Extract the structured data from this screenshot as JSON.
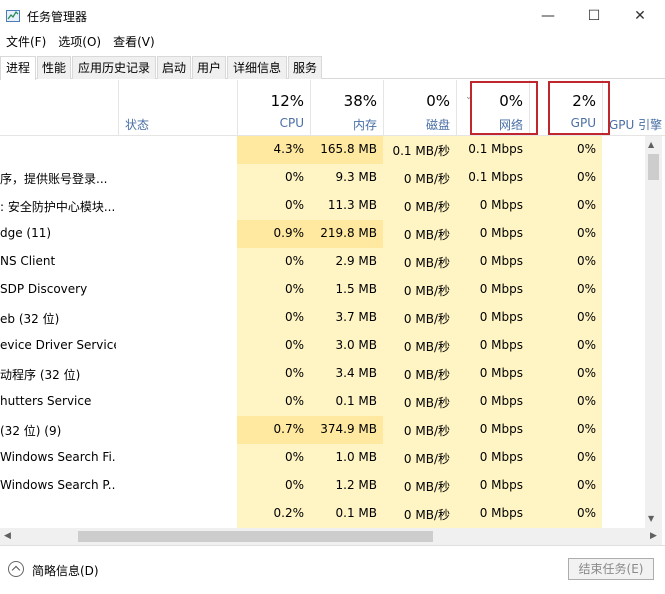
{
  "window": {
    "title": "任务管理器",
    "minimize": "—",
    "maximize": "☐",
    "close": "✕"
  },
  "menu": [
    "文件(F)",
    "选项(O)",
    "查看(V)"
  ],
  "tabs": [
    "进程",
    "性能",
    "应用历史记录",
    "启动",
    "用户",
    "详细信息",
    "服务"
  ],
  "active_tab": "进程",
  "columns": {
    "status": "状态",
    "cpu": {
      "percent": "12%",
      "label": "CPU"
    },
    "memory": {
      "percent": "38%",
      "label": "内存"
    },
    "disk": {
      "percent": "0%",
      "label": "磁盘"
    },
    "network": {
      "percent": "0%",
      "label": "网络"
    },
    "gpu": {
      "percent": "2%",
      "label": "GPU"
    },
    "gpu_engine": "GPU 引擎"
  },
  "rows": [
    {
      "name": "",
      "cpu": "4.3%",
      "memory": "165.8 MB",
      "disk": "0.1 MB/秒",
      "network": "0.1 Mbps",
      "gpu": "0%"
    },
    {
      "name": "序，提供账号登录...",
      "cpu": "0%",
      "memory": "9.3 MB",
      "disk": "0 MB/秒",
      "network": "0.1 Mbps",
      "gpu": "0%"
    },
    {
      "name": ": 安全防护中心模块...",
      "cpu": "0%",
      "memory": "11.3 MB",
      "disk": "0 MB/秒",
      "network": "0 Mbps",
      "gpu": "0%"
    },
    {
      "name": "dge (11)",
      "cpu": "0.9%",
      "memory": "219.8 MB",
      "disk": "0 MB/秒",
      "network": "0 Mbps",
      "gpu": "0%"
    },
    {
      "name": "NS Client",
      "cpu": "0%",
      "memory": "2.9 MB",
      "disk": "0 MB/秒",
      "network": "0 Mbps",
      "gpu": "0%"
    },
    {
      "name": "SDP Discovery",
      "cpu": "0%",
      "memory": "1.5 MB",
      "disk": "0 MB/秒",
      "network": "0 Mbps",
      "gpu": "0%"
    },
    {
      "name": "eb (32 位)",
      "cpu": "0%",
      "memory": "3.7 MB",
      "disk": "0 MB/秒",
      "network": "0 Mbps",
      "gpu": "0%"
    },
    {
      "name": "evice Driver Service",
      "cpu": "0%",
      "memory": "3.0 MB",
      "disk": "0 MB/秒",
      "network": "0 Mbps",
      "gpu": "0%"
    },
    {
      "name": "动程序 (32 位)",
      "cpu": "0%",
      "memory": "3.4 MB",
      "disk": "0 MB/秒",
      "network": "0 Mbps",
      "gpu": "0%"
    },
    {
      "name": "hutters Service",
      "cpu": "0%",
      "memory": "0.1 MB",
      "disk": "0 MB/秒",
      "network": "0 Mbps",
      "gpu": "0%"
    },
    {
      "name": "(32 位) (9)",
      "cpu": "0.7%",
      "memory": "374.9 MB",
      "disk": "0 MB/秒",
      "network": "0 Mbps",
      "gpu": "0%"
    },
    {
      "name": "Windows Search Fi...",
      "cpu": "0%",
      "memory": "1.0 MB",
      "disk": "0 MB/秒",
      "network": "0 Mbps",
      "gpu": "0%"
    },
    {
      "name": "Windows Search P...",
      "cpu": "0%",
      "memory": "1.2 MB",
      "disk": "0 MB/秒",
      "network": "0 Mbps",
      "gpu": "0%"
    },
    {
      "name": "",
      "cpu": "0.2%",
      "memory": "0.1 MB",
      "disk": "0 MB/秒",
      "network": "0 Mbps",
      "gpu": "0%"
    }
  ],
  "footer": {
    "fewer_details": "简略信息(D)",
    "end_task": "结束任务(E)"
  },
  "colors": {
    "heat_light": "#fff4c4",
    "heat_medium": "#ffe9a0",
    "highlight_border": "#c0272d",
    "header_label": "#4a6fa5"
  }
}
